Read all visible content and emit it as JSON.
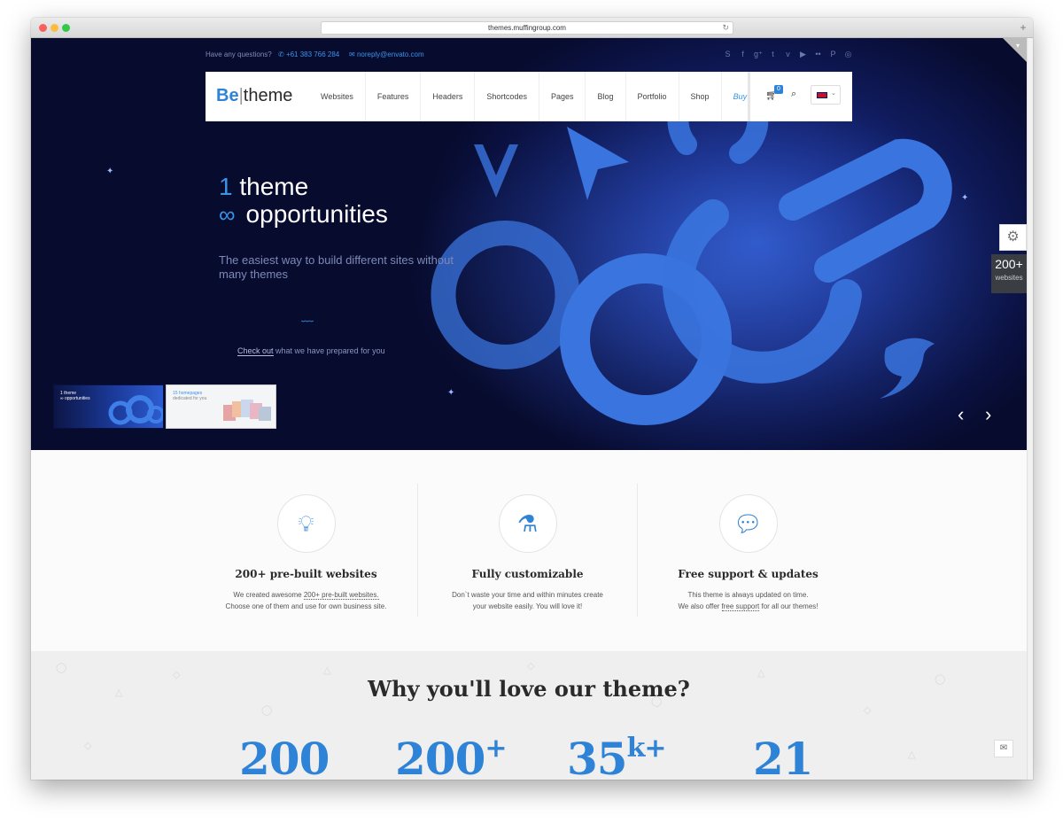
{
  "browser": {
    "url": "themes.muffingroup.com",
    "reload_icon": "reload-icon",
    "newtab_icon": "plus-icon"
  },
  "topbar": {
    "question": "Have any questions?",
    "phone": "+61 383 766 284",
    "email": "noreply@envato.com",
    "social_icons": [
      "skype-icon",
      "facebook-icon",
      "google-plus-icon",
      "twitter-icon",
      "vimeo-icon",
      "youtube-icon",
      "flickr-icon",
      "pinterest-icon",
      "dribbble-icon"
    ]
  },
  "logo": {
    "be": "Be",
    "sep": "|",
    "theme": "theme"
  },
  "menu": [
    "Websites",
    "Features",
    "Headers",
    "Shortcodes",
    "Pages",
    "Blog",
    "Portfolio",
    "Shop",
    "Buy"
  ],
  "cart_count": "0",
  "hero": {
    "title_num": "1",
    "title_line1": "theme",
    "title_line2": "opportunities",
    "subtitle": "The easiest way to build different sites without many themes",
    "check_link": "Check out",
    "check_rest": "what we have prepared for you",
    "thumbs": [
      {
        "line1": "1 theme",
        "line2": "∞ opportunities"
      },
      {
        "line1": "15 homepages",
        "line2": "dedicated for you"
      }
    ]
  },
  "side_panel": {
    "count": "200+",
    "label": "websites"
  },
  "features": [
    {
      "icon": "lightbulb-icon",
      "title": "200+ pre-built websites",
      "desc1_pre": "We created awesome ",
      "desc1_link": "200+ pre-built websites.",
      "desc2": "Choose one of them and use for own business site."
    },
    {
      "icon": "flask-icon",
      "title": "Fully customizable",
      "desc1_pre": "Don`t waste your time and within minutes create",
      "desc1_link": "",
      "desc2": "your website easily. You will love it!"
    },
    {
      "icon": "speech-bubble-icon",
      "title": "Free support & updates",
      "desc1_pre": "This theme is always updated on time.",
      "desc1_link": "",
      "desc2_pre": "We also offer ",
      "desc2_link": "free support",
      "desc2_post": " for all our themes!"
    }
  ],
  "why": {
    "title": "Why you'll love our theme?",
    "stats": [
      {
        "value": "200",
        "suffix": ""
      },
      {
        "value": "200",
        "suffix": "+"
      },
      {
        "value": "35",
        "suffix": "k+"
      },
      {
        "value": "21",
        "suffix": ""
      }
    ]
  },
  "colors": {
    "accent": "#2f83d6",
    "hero_dark": "#070b2e",
    "text_dark": "#2a2a2a"
  }
}
